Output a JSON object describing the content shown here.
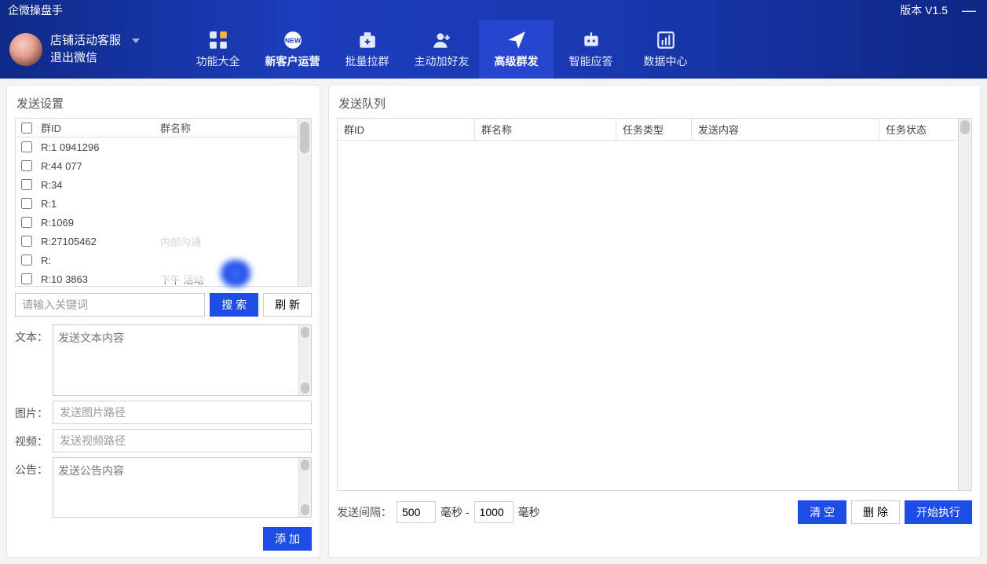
{
  "titlebar": {
    "app_name": "企微操盘手",
    "version": "版本 V1.5"
  },
  "user": {
    "name": "店铺活动客服",
    "logout": "退出微信"
  },
  "nav": [
    {
      "label": "功能大全",
      "icon": "grid"
    },
    {
      "label": "新客户运营",
      "icon": "new-badge",
      "bold": true
    },
    {
      "label": "批量拉群",
      "icon": "medkit"
    },
    {
      "label": "主动加好友",
      "icon": "add-user"
    },
    {
      "label": "高级群发",
      "icon": "send",
      "active": true
    },
    {
      "label": "智能应答",
      "icon": "robot"
    },
    {
      "label": "数据中心",
      "icon": "chart"
    }
  ],
  "left": {
    "title": "发送设置",
    "columns": {
      "id": "群ID",
      "name": "群名称"
    },
    "rows": [
      {
        "id": "R:1             0941296",
        "name": ""
      },
      {
        "id": "R:44              077",
        "name": ""
      },
      {
        "id": "R:34",
        "name": ""
      },
      {
        "id": "R:1",
        "name": ""
      },
      {
        "id": "R:1069",
        "name": ""
      },
      {
        "id": "R:27105462",
        "name": "内部沟通"
      },
      {
        "id": "R:",
        "name": ""
      },
      {
        "id": "R:10           3863",
        "name": "下午            活动"
      }
    ],
    "search": {
      "placeholder": "请输入关键词",
      "btn": "搜 索",
      "refresh": "刷 新"
    },
    "form": {
      "text_label": "文本：",
      "text_ph": "发送文本内容",
      "img_label": "图片：",
      "img_ph": "发送图片路径",
      "video_label": "视频：",
      "video_ph": "发送视频路径",
      "notice_label": "公告：",
      "notice_ph": "发送公告内容"
    },
    "add_btn": "添 加"
  },
  "right": {
    "title": "发送队列",
    "columns": {
      "id": "群ID",
      "name": "群名称",
      "type": "任务类型",
      "content": "发送内容",
      "status": "任务状态"
    },
    "interval_label": "发送间隔：",
    "interval_min": "500",
    "interval_sep": "毫秒 -",
    "interval_max": "1000",
    "interval_unit": "毫秒",
    "clear_btn": "清 空",
    "delete_btn": "删 除",
    "start_btn": "开始执行"
  }
}
